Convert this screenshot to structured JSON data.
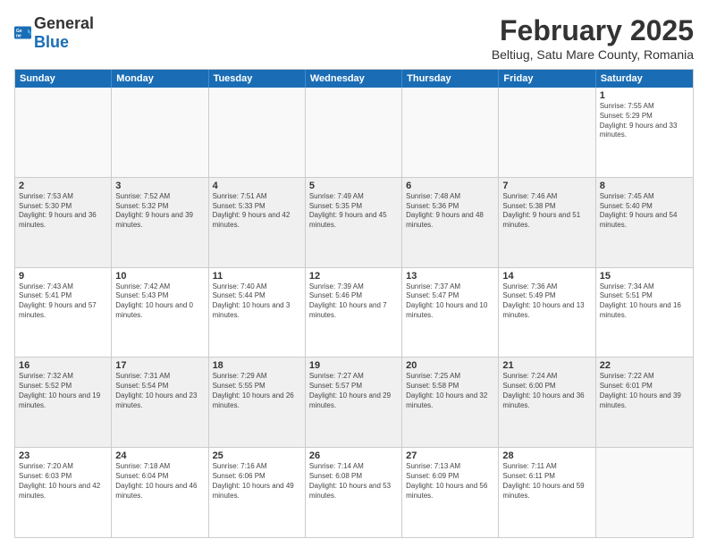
{
  "header": {
    "logo": {
      "general": "General",
      "blue": "Blue"
    },
    "title": "February 2025",
    "subtitle": "Beltiug, Satu Mare County, Romania"
  },
  "calendar": {
    "days": [
      "Sunday",
      "Monday",
      "Tuesday",
      "Wednesday",
      "Thursday",
      "Friday",
      "Saturday"
    ],
    "rows": [
      [
        {
          "day": "",
          "info": "",
          "empty": true
        },
        {
          "day": "",
          "info": "",
          "empty": true
        },
        {
          "day": "",
          "info": "",
          "empty": true
        },
        {
          "day": "",
          "info": "",
          "empty": true
        },
        {
          "day": "",
          "info": "",
          "empty": true
        },
        {
          "day": "",
          "info": "",
          "empty": true
        },
        {
          "day": "1",
          "info": "Sunrise: 7:55 AM\nSunset: 5:29 PM\nDaylight: 9 hours and 33 minutes."
        }
      ],
      [
        {
          "day": "2",
          "info": "Sunrise: 7:53 AM\nSunset: 5:30 PM\nDaylight: 9 hours and 36 minutes."
        },
        {
          "day": "3",
          "info": "Sunrise: 7:52 AM\nSunset: 5:32 PM\nDaylight: 9 hours and 39 minutes."
        },
        {
          "day": "4",
          "info": "Sunrise: 7:51 AM\nSunset: 5:33 PM\nDaylight: 9 hours and 42 minutes."
        },
        {
          "day": "5",
          "info": "Sunrise: 7:49 AM\nSunset: 5:35 PM\nDaylight: 9 hours and 45 minutes."
        },
        {
          "day": "6",
          "info": "Sunrise: 7:48 AM\nSunset: 5:36 PM\nDaylight: 9 hours and 48 minutes."
        },
        {
          "day": "7",
          "info": "Sunrise: 7:46 AM\nSunset: 5:38 PM\nDaylight: 9 hours and 51 minutes."
        },
        {
          "day": "8",
          "info": "Sunrise: 7:45 AM\nSunset: 5:40 PM\nDaylight: 9 hours and 54 minutes."
        }
      ],
      [
        {
          "day": "9",
          "info": "Sunrise: 7:43 AM\nSunset: 5:41 PM\nDaylight: 9 hours and 57 minutes."
        },
        {
          "day": "10",
          "info": "Sunrise: 7:42 AM\nSunset: 5:43 PM\nDaylight: 10 hours and 0 minutes."
        },
        {
          "day": "11",
          "info": "Sunrise: 7:40 AM\nSunset: 5:44 PM\nDaylight: 10 hours and 3 minutes."
        },
        {
          "day": "12",
          "info": "Sunrise: 7:39 AM\nSunset: 5:46 PM\nDaylight: 10 hours and 7 minutes."
        },
        {
          "day": "13",
          "info": "Sunrise: 7:37 AM\nSunset: 5:47 PM\nDaylight: 10 hours and 10 minutes."
        },
        {
          "day": "14",
          "info": "Sunrise: 7:36 AM\nSunset: 5:49 PM\nDaylight: 10 hours and 13 minutes."
        },
        {
          "day": "15",
          "info": "Sunrise: 7:34 AM\nSunset: 5:51 PM\nDaylight: 10 hours and 16 minutes."
        }
      ],
      [
        {
          "day": "16",
          "info": "Sunrise: 7:32 AM\nSunset: 5:52 PM\nDaylight: 10 hours and 19 minutes."
        },
        {
          "day": "17",
          "info": "Sunrise: 7:31 AM\nSunset: 5:54 PM\nDaylight: 10 hours and 23 minutes."
        },
        {
          "day": "18",
          "info": "Sunrise: 7:29 AM\nSunset: 5:55 PM\nDaylight: 10 hours and 26 minutes."
        },
        {
          "day": "19",
          "info": "Sunrise: 7:27 AM\nSunset: 5:57 PM\nDaylight: 10 hours and 29 minutes."
        },
        {
          "day": "20",
          "info": "Sunrise: 7:25 AM\nSunset: 5:58 PM\nDaylight: 10 hours and 32 minutes."
        },
        {
          "day": "21",
          "info": "Sunrise: 7:24 AM\nSunset: 6:00 PM\nDaylight: 10 hours and 36 minutes."
        },
        {
          "day": "22",
          "info": "Sunrise: 7:22 AM\nSunset: 6:01 PM\nDaylight: 10 hours and 39 minutes."
        }
      ],
      [
        {
          "day": "23",
          "info": "Sunrise: 7:20 AM\nSunset: 6:03 PM\nDaylight: 10 hours and 42 minutes."
        },
        {
          "day": "24",
          "info": "Sunrise: 7:18 AM\nSunset: 6:04 PM\nDaylight: 10 hours and 46 minutes."
        },
        {
          "day": "25",
          "info": "Sunrise: 7:16 AM\nSunset: 6:06 PM\nDaylight: 10 hours and 49 minutes."
        },
        {
          "day": "26",
          "info": "Sunrise: 7:14 AM\nSunset: 6:08 PM\nDaylight: 10 hours and 53 minutes."
        },
        {
          "day": "27",
          "info": "Sunrise: 7:13 AM\nSunset: 6:09 PM\nDaylight: 10 hours and 56 minutes."
        },
        {
          "day": "28",
          "info": "Sunrise: 7:11 AM\nSunset: 6:11 PM\nDaylight: 10 hours and 59 minutes."
        },
        {
          "day": "",
          "info": "",
          "empty": true
        }
      ]
    ]
  }
}
